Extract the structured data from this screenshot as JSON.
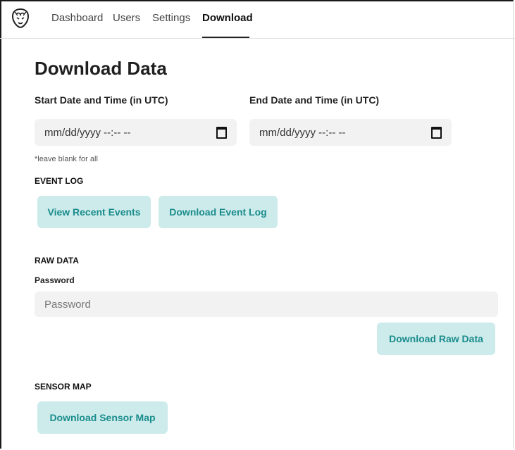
{
  "nav": {
    "items": [
      {
        "label": "Dashboard"
      },
      {
        "label": "Users"
      },
      {
        "label": "Settings"
      },
      {
        "label": "Download"
      }
    ],
    "active": "Download"
  },
  "page": {
    "title": "Download Data",
    "start_label": "Start Date and Time (in UTC)",
    "end_label": "End Date and Time (in UTC)",
    "start_placeholder": "mm/dd/yyyy --:-- --",
    "end_placeholder": "mm/dd/yyyy --:-- --",
    "hint": "*leave blank for all"
  },
  "event_log": {
    "heading": "EVENT LOG",
    "view_button": "View Recent Events",
    "download_button": "Download Event Log"
  },
  "raw_data": {
    "heading": "RAW DATA",
    "password_label": "Password",
    "password_placeholder": "Password",
    "download_button": "Download Raw Data"
  },
  "sensor_map": {
    "heading": "SENSOR MAP",
    "download_button": "Download Sensor Map"
  },
  "colors": {
    "button_bg": "#cdebeb",
    "button_text": "#1b8c8c",
    "input_bg": "#f2f2f2"
  }
}
